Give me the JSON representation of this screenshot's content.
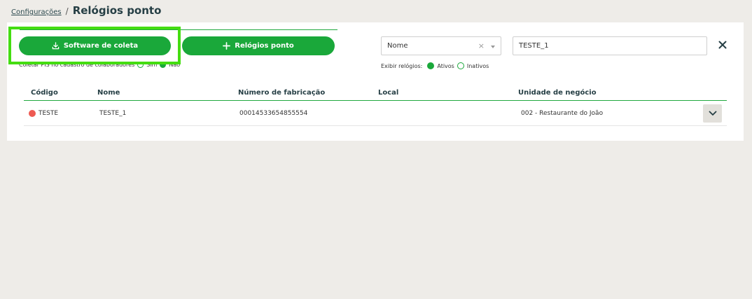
{
  "breadcrumb": {
    "parent": "Configurações",
    "separator": "/",
    "title": "Relógios ponto"
  },
  "actions": {
    "software_label": "Software de coleta",
    "add_label": "Relógios ponto"
  },
  "hidden_option": {
    "label": "Coletar PIS no cadastro de colaboradores",
    "yes": "Sim",
    "no": "Não"
  },
  "search": {
    "field_select": "Nome",
    "value": "TESTE_1"
  },
  "filter": {
    "label": "Exibir relógios:",
    "active": "Ativos",
    "inactive": "Inativos"
  },
  "table": {
    "headers": {
      "code": "Código",
      "name": "Nome",
      "serial": "Número de fabricação",
      "local": "Local",
      "unit": "Unidade de negócio"
    },
    "rows": [
      {
        "code": "TESTE",
        "name": "TESTE_1",
        "serial": "00014533654855554",
        "local": "",
        "unit": "002 - Restaurante do João",
        "status_color": "#ee5a52"
      }
    ]
  },
  "colors": {
    "accent": "#1aa83a",
    "highlight": "#44dd11",
    "status_inactive": "#ee5a52"
  }
}
